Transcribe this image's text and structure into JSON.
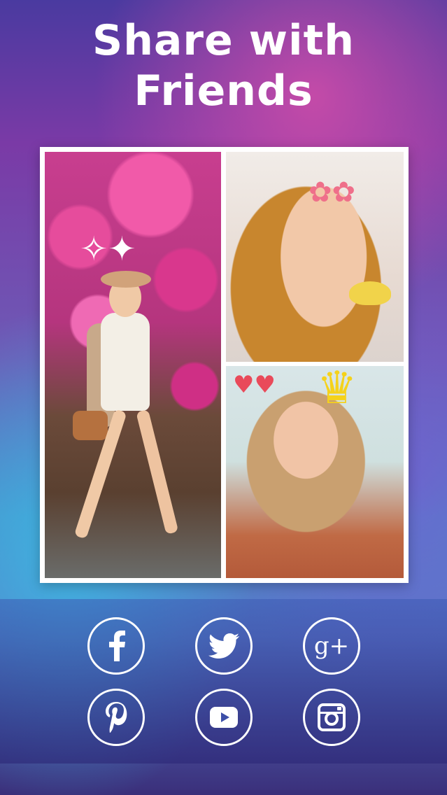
{
  "headline": {
    "line1": "Share with",
    "line2": "Friends"
  },
  "share_buttons": [
    {
      "name": "facebook",
      "icon": "facebook-icon"
    },
    {
      "name": "twitter",
      "icon": "twitter-icon"
    },
    {
      "name": "google-plus",
      "icon": "google-plus-icon",
      "glyph": "g+"
    },
    {
      "name": "pinterest",
      "icon": "pinterest-icon"
    },
    {
      "name": "youtube",
      "icon": "youtube-icon"
    },
    {
      "name": "instagram",
      "icon": "instagram-icon"
    }
  ],
  "colors": {
    "headline_text": "#ffffff",
    "icon_stroke": "#ffffff",
    "collage_border": "#ffffff"
  }
}
